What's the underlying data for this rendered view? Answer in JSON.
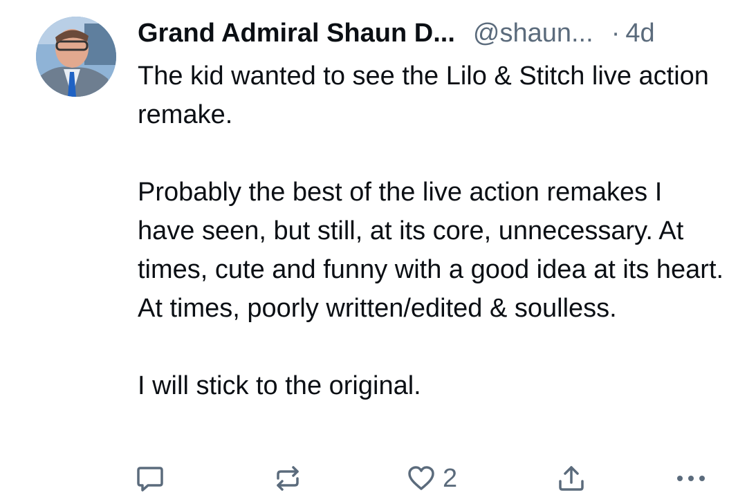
{
  "post": {
    "author": {
      "display_name": "Grand Admiral Shaun D...",
      "handle": "@shaun...",
      "avatar_icon": "profile-photo"
    },
    "separator": "·",
    "timestamp": "4d",
    "paragraphs": {
      "p1": "The kid wanted to see the Lilo & Stitch live action remake.",
      "p2": "Probably the best of the live action remakes I have seen, but still, at its core, unnecessary. At times, cute and funny with a good idea at its heart. At times, poorly written/edited & soulless.",
      "p3": "I will stick to the original."
    },
    "actions": {
      "reply_icon": "speech-bubble-icon",
      "repost_icon": "repost-arrows-icon",
      "like_icon": "heart-icon",
      "like_count": "2",
      "share_icon": "share-upload-icon",
      "more_icon": "ellipsis-icon"
    }
  },
  "colors": {
    "text_primary": "#0b0f14",
    "text_secondary": "#5b6b7c",
    "background": "#ffffff"
  }
}
